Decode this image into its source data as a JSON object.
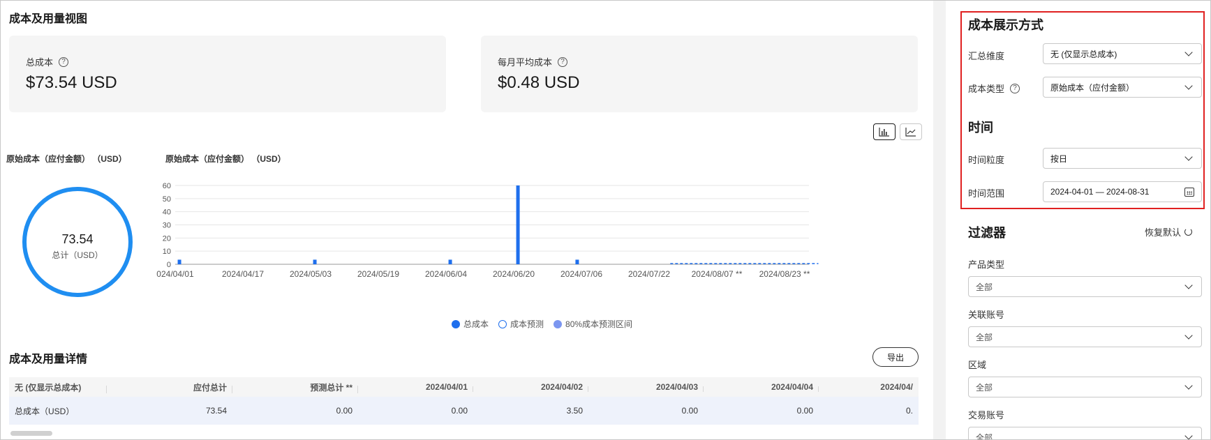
{
  "page": {
    "title": "成本及用量视图"
  },
  "kpis": [
    {
      "label": "总成本",
      "value": "$73.54 USD"
    },
    {
      "label": "每月平均成本",
      "value": "$0.48 USD"
    }
  ],
  "chart_toggle": {
    "bar_icon": "bar-chart-icon",
    "line_icon": "line-chart-icon",
    "active": "bar"
  },
  "donut": {
    "title": "原始成本（应付金额） （USD）",
    "value": "73.54",
    "label": "总计（USD）",
    "color": "#1f8ef1"
  },
  "chart_data": {
    "type": "bar",
    "title": "原始成本（应付金额） （USD）",
    "x_range": [
      "2024-04-01",
      "2024-08-31"
    ],
    "ylim": [
      0,
      60
    ],
    "yticks": [
      0,
      10,
      20,
      30,
      40,
      50,
      60
    ],
    "xtick_labels": [
      "024/04/01",
      "2024/04/17",
      "2024/05/03",
      "2024/05/19",
      "2024/06/04",
      "2024/06/20",
      "2024/07/06",
      "2024/07/22",
      "2024/08/07 **",
      "2024/08/23 **"
    ],
    "series": [
      {
        "name": "总成本",
        "points": [
          {
            "x": "2024-04-02",
            "y": 3.5
          },
          {
            "x": "2024-05-04",
            "y": 3.5
          },
          {
            "x": "2024-06-05",
            "y": 3.5
          },
          {
            "x": "2024-06-21",
            "y": 60
          },
          {
            "x": "2024-07-05",
            "y": 3.5
          }
        ]
      },
      {
        "name": "成本预测",
        "points": [
          {
            "x": "2024-07-27",
            "y": 0
          },
          {
            "x": "2024-08-31",
            "y": 0
          }
        ]
      }
    ],
    "grid": true,
    "colors": {
      "bar": "#1f6fed",
      "forecast": "#1f6fed",
      "grid": "#e6e6e6"
    }
  },
  "legend": [
    {
      "label": "总成本",
      "style": "solid"
    },
    {
      "label": "成本预测",
      "style": "outline"
    },
    {
      "label": "80%成本预测区间",
      "style": "light"
    }
  ],
  "details": {
    "title": "成本及用量详情",
    "export_label": "导出",
    "columns": [
      "无 (仅显示总成本)",
      "应付总计",
      "预测总计 **",
      "2024/04/01",
      "2024/04/02",
      "2024/04/03",
      "2024/04/04",
      "2024/04/"
    ],
    "rows": [
      [
        "总成本（USD）",
        "73.54",
        "0.00",
        "0.00",
        "3.50",
        "0.00",
        "0.00",
        "0."
      ]
    ]
  },
  "panel": {
    "display_title": "成本展示方式",
    "summary_label": "汇总维度",
    "summary_value": "无 (仅显示总成本)",
    "cost_type_label": "成本类型",
    "cost_type_value": "原始成本（应付金额）",
    "time_title": "时间",
    "granularity_label": "时间粒度",
    "granularity_value": "按日",
    "range_label": "时间范围",
    "range_value": "2024-04-01 — 2024-08-31",
    "filter_title": "过滤器",
    "reset_label": "恢复默认",
    "filters": [
      {
        "label": "产品类型",
        "value": "全部"
      },
      {
        "label": "关联账号",
        "value": "全部"
      },
      {
        "label": "区域",
        "value": "全部"
      },
      {
        "label": "交易账号",
        "value": "全部"
      }
    ],
    "highlight_color": "#e02020"
  }
}
